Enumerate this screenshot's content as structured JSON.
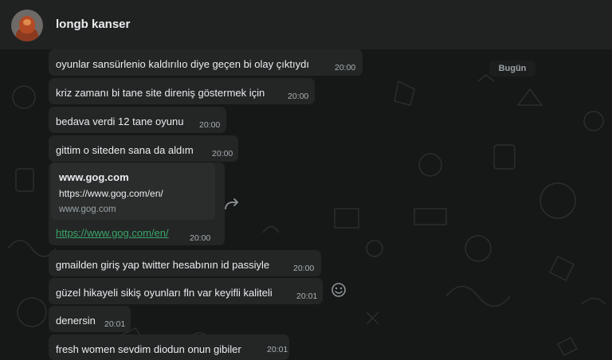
{
  "header": {
    "contact_name": "longb kanser"
  },
  "date_chip": "Bugün",
  "messages": [
    {
      "text": "oyunlar sansürlenio kaldırılıo diye geçen bi olay çıktıydı",
      "time": "20:00"
    },
    {
      "text": "kriz zamanı bi tane site direniş göstermek için",
      "time": "20:00"
    },
    {
      "text": "bedava verdi 12 tane oyunu",
      "time": "20:00"
    },
    {
      "text": "gittim o siteden sana da aldım",
      "time": "20:00"
    },
    {
      "text": "gmailden giriş yap twitter hesabının id passiyle",
      "time": "20:00"
    },
    {
      "text": "güzel hikayeli sikiş oyunları fln var keyifli kaliteli",
      "time": "20:01"
    },
    {
      "text": "denersin",
      "time": "20:01"
    },
    {
      "text": "fresh women sevdim diodun onun gibiler",
      "time": "20:01"
    }
  ],
  "link_message": {
    "preview_title": "www.gog.com",
    "preview_url": "https://www.gog.com/en/",
    "preview_domain": "www.gog.com",
    "link_text": "https://www.gog.com/en/",
    "time": "20:00"
  },
  "icons": {
    "forward": "forward-arrow-icon",
    "react": "smiley-icon"
  }
}
